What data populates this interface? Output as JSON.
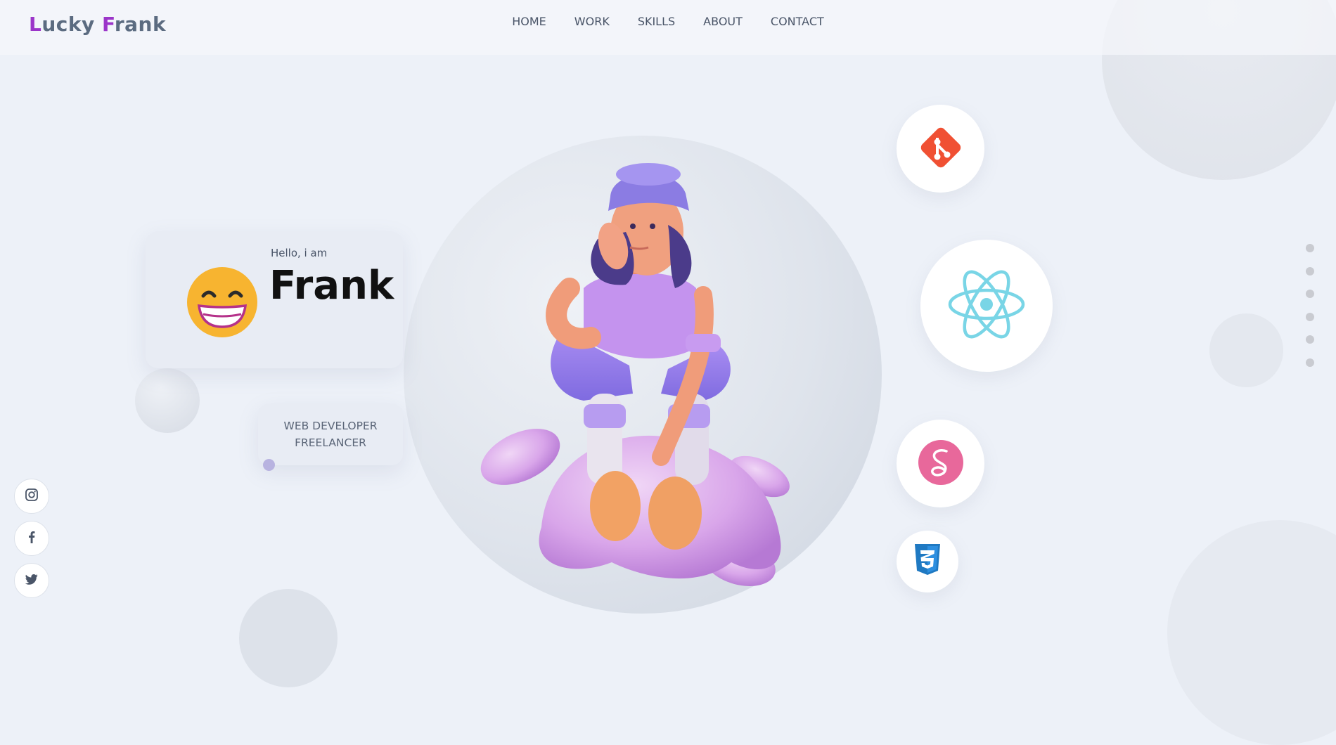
{
  "brand": {
    "first_letter": "L",
    "first_rest": "ucky ",
    "second_letter": "F",
    "second_rest": "rank",
    "accent_color": "#9b35c9"
  },
  "nav": {
    "items": [
      "HOME",
      "WORK",
      "SKILLS",
      "ABOUT",
      "CONTACT"
    ]
  },
  "intro": {
    "greeting": "Hello, i am",
    "name": "Frank"
  },
  "role": {
    "line1": "WEB DEVELOPER",
    "line2": "FREELANCER"
  },
  "tech_icons": [
    "git-icon",
    "react-icon",
    "sass-icon",
    "css3-icon"
  ],
  "social_icons": [
    "instagram-icon",
    "facebook-icon",
    "twitter-icon"
  ],
  "section_dots": 6,
  "colors": {
    "background": "#edf1f8",
    "git": "#f05033",
    "react": "#79d5e6",
    "sass": "#e8689b",
    "css3": "#1f79c2"
  }
}
